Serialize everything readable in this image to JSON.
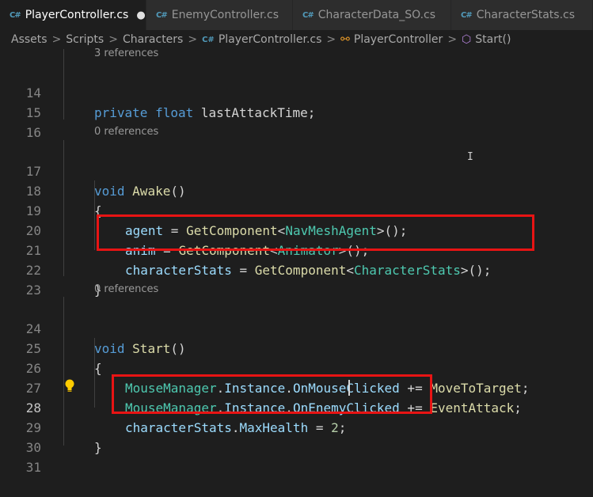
{
  "tabs": [
    {
      "label": "PlayerController.cs",
      "active": true,
      "modified_indicator": "●"
    },
    {
      "label": "EnemyController.cs"
    },
    {
      "label": "CharacterData_SO.cs"
    },
    {
      "label": "CharacterStats.cs"
    }
  ],
  "breadcrumb": {
    "items": [
      "Assets",
      "Scripts",
      "Characters",
      "PlayerController.cs",
      "PlayerController",
      "Start()"
    ],
    "separator": ">"
  },
  "editor": {
    "codelens": {
      "top": "3 references",
      "awake": "0 references",
      "start": "0 references"
    },
    "line_numbers": [
      "14",
      "15",
      "16",
      "17",
      "18",
      "19",
      "20",
      "21",
      "22",
      "23",
      "24",
      "25",
      "26",
      "27",
      "28",
      "29",
      "30",
      "31"
    ],
    "tokens": {
      "private": "private",
      "float": "float",
      "lastAttackTime": "lastAttackTime",
      "semicolon": ";",
      "void": "void",
      "Awake": "Awake",
      "Start": "Start",
      "parens": "()",
      "open_brace": "{",
      "close_brace": "}",
      "agent": "agent",
      "anim": "anim",
      "characterStats": "characterStats",
      "assign": " = ",
      "GetComponent": "GetComponent",
      "lt": "<",
      "gt_call": ">();",
      "NavMeshAgent": "NavMeshAgent",
      "Animator": "Animator",
      "CharacterStats": "CharacterStats",
      "MouseManager": "MouseManager",
      "dot": ".",
      "Instance": "Instance",
      "OnMouseClicked": "OnMouseClicked",
      "OnEnemyClicked": "OnEnemyClicked",
      "plus_assign": " += ",
      "MoveToTarget": "MoveToTarget",
      "EventAttack": "EventAttack",
      "MaxHealth": "MaxHealth",
      "value_2": "2"
    }
  },
  "colors": {
    "background": "#1e1e1e",
    "keyword": "#569cd6",
    "function": "#dcdcaa",
    "type": "#4ec9b0",
    "variable": "#9cdcfe",
    "number": "#b5cea8",
    "highlight_box": "#e81414"
  },
  "icons": [
    "csharp-file-icon",
    "class-icon",
    "method-icon",
    "lightbulb-icon"
  ]
}
